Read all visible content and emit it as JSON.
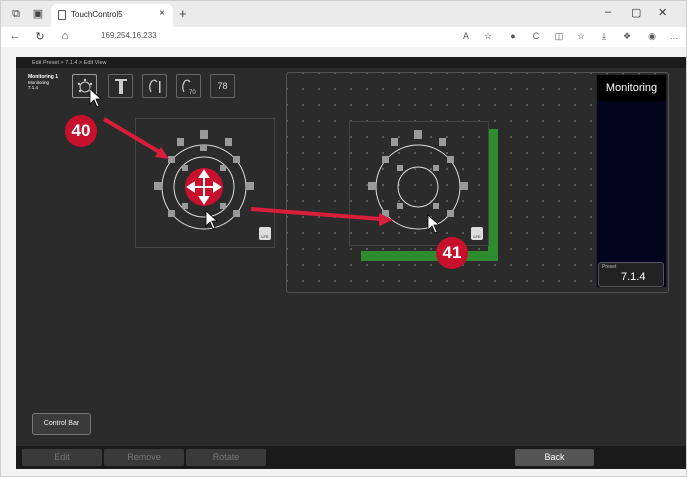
{
  "browser": {
    "tab_title": "TouchControl5",
    "url": "169.254.16.233",
    "new_tab": "+",
    "tab_close": "×"
  },
  "app": {
    "breadcrumb": "Edit Preset > 7.1.4 > Edit View",
    "preset_info": {
      "name": "Monitoring 1",
      "sub": "Monitoring",
      "preset": "7.1.4"
    },
    "toolbar_last": "78",
    "monitoring_label": "Monitoring",
    "preset_box": {
      "label": "Preset",
      "value": "7.1.4"
    },
    "control_bar_label": "Control Bar",
    "lfe_label": "LFE",
    "bottom_buttons": {
      "edit": "Edit",
      "remove": "Remove",
      "rotate": "Rotate",
      "back": "Back"
    }
  },
  "callouts": {
    "a": "40",
    "b": "41"
  },
  "colors": {
    "callout": "#c6102c",
    "grid_floor": "#2e8b2e",
    "monitor_panel": "#04041e"
  }
}
